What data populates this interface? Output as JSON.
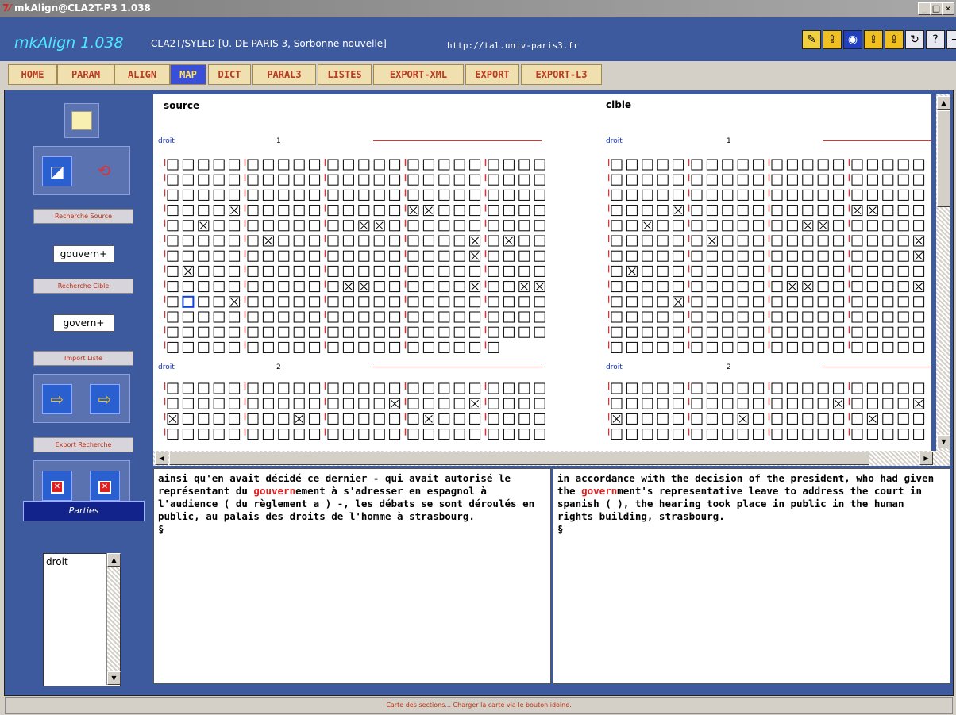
{
  "window": {
    "title": "mkAlign@CLA2T-P3 1.038",
    "buttons": [
      "_",
      "□",
      "×"
    ]
  },
  "header": {
    "app_title": "mkAlign 1.038",
    "subtitle": "CLA2T/SYLED [U. DE PARIS 3, Sorbonne nouvelle]",
    "url": "http://tal.univ-paris3.fr",
    "tool_icons": [
      "edit-icon",
      "folder-up-icon",
      "globe-icon",
      "folder-up-icon",
      "folder-up-icon",
      "refresh-icon",
      "help-icon",
      "exit-icon"
    ],
    "tool_glyphs": [
      "✎",
      "⇪",
      "◉",
      "⇪",
      "⇪",
      "↻",
      "?",
      "⇥"
    ]
  },
  "tabs": [
    "HOME",
    "PARAM",
    "ALIGN",
    "MAP",
    "DICT",
    "PARAL3",
    "LISTES",
    "EXPORT-XML",
    "EXPORT",
    "EXPORT-L3"
  ],
  "active_tab": "MAP",
  "sidebar": {
    "recherche_source_label": "Recherche Source",
    "recherche_source_value": "gouvern+",
    "recherche_cible_label": "Recherche Cible",
    "recherche_cible_value": "govern+",
    "import_liste_label": "Import Liste",
    "export_recherche_label": "Export Recherche",
    "parties_label": "Parties",
    "parties_items": [
      "droit"
    ]
  },
  "map": {
    "source_header": "source",
    "cible_header": "cible",
    "parts": [
      {
        "label": "droit",
        "number": "1"
      },
      {
        "label": "droit",
        "number": "2"
      }
    ]
  },
  "text": {
    "source_before": " ainsi qu'en avait décidé ce dernier - qui avait autorisé le représentant du ",
    "source_hl": "gouvern",
    "source_after": "ement à s'adresser en espagnol à l'audience ( du règlement a ) -, les débats se sont déroulés en public, au palais des droits de l'homme à strasbourg.",
    "source_end": "§",
    "target_before": " in accordance with the decision of the president, who had given the ",
    "target_hl": "govern",
    "target_after": "ment's representative leave to address the court in spanish ( ), the hearing took place in public in the human rights building, strasbourg.",
    "target_end": "§"
  },
  "status": "Carte des sections... Charger la carte via le bouton idoine.",
  "colors": {
    "header_bg": "#3e5a9e",
    "accent_title": "#4de8ff",
    "tab_bg": "#f0e0b0",
    "tab_active_bg": "#3a4fd8",
    "highlight": "#e02020"
  }
}
